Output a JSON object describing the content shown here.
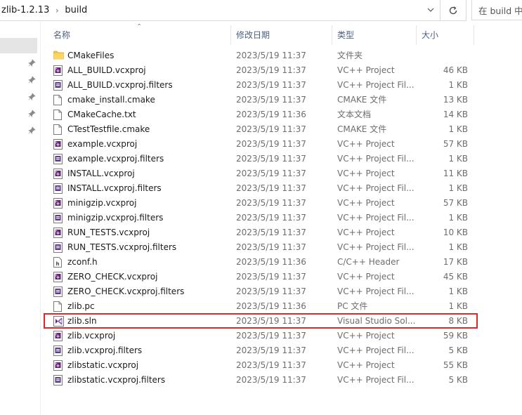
{
  "address": {
    "crumbs": [
      "zlib-1.2.13",
      "build"
    ],
    "search_placeholder": "在 build 中"
  },
  "columns": {
    "name": "名称",
    "date": "修改日期",
    "type": "类型",
    "size": "大小"
  },
  "files": [
    {
      "icon": "folder",
      "name": "CMakeFiles",
      "date": "2023/5/19 11:37",
      "type": "文件夹",
      "size": ""
    },
    {
      "icon": "vcxproj",
      "name": "ALL_BUILD.vcxproj",
      "date": "2023/5/19 11:37",
      "type": "VC++ Project",
      "size": "46 KB"
    },
    {
      "icon": "filters",
      "name": "ALL_BUILD.vcxproj.filters",
      "date": "2023/5/19 11:37",
      "type": "VC++ Project Fil...",
      "size": "1 KB"
    },
    {
      "icon": "document",
      "name": "cmake_install.cmake",
      "date": "2023/5/19 11:37",
      "type": "CMAKE 文件",
      "size": "13 KB"
    },
    {
      "icon": "document",
      "name": "CMakeCache.txt",
      "date": "2023/5/19 11:36",
      "type": "文本文档",
      "size": "14 KB"
    },
    {
      "icon": "document",
      "name": "CTestTestfile.cmake",
      "date": "2023/5/19 11:37",
      "type": "CMAKE 文件",
      "size": "1 KB"
    },
    {
      "icon": "vcxproj",
      "name": "example.vcxproj",
      "date": "2023/5/19 11:37",
      "type": "VC++ Project",
      "size": "57 KB"
    },
    {
      "icon": "filters",
      "name": "example.vcxproj.filters",
      "date": "2023/5/19 11:37",
      "type": "VC++ Project Fil...",
      "size": "1 KB"
    },
    {
      "icon": "vcxproj",
      "name": "INSTALL.vcxproj",
      "date": "2023/5/19 11:37",
      "type": "VC++ Project",
      "size": "11 KB"
    },
    {
      "icon": "filters",
      "name": "INSTALL.vcxproj.filters",
      "date": "2023/5/19 11:37",
      "type": "VC++ Project Fil...",
      "size": "1 KB"
    },
    {
      "icon": "vcxproj",
      "name": "minigzip.vcxproj",
      "date": "2023/5/19 11:37",
      "type": "VC++ Project",
      "size": "57 KB"
    },
    {
      "icon": "filters",
      "name": "minigzip.vcxproj.filters",
      "date": "2023/5/19 11:37",
      "type": "VC++ Project Fil...",
      "size": "1 KB"
    },
    {
      "icon": "vcxproj",
      "name": "RUN_TESTS.vcxproj",
      "date": "2023/5/19 11:37",
      "type": "VC++ Project",
      "size": "10 KB"
    },
    {
      "icon": "filters",
      "name": "RUN_TESTS.vcxproj.filters",
      "date": "2023/5/19 11:37",
      "type": "VC++ Project Fil...",
      "size": "1 KB"
    },
    {
      "icon": "header",
      "name": "zconf.h",
      "date": "2023/5/19 11:36",
      "type": "C/C++ Header",
      "size": "17 KB"
    },
    {
      "icon": "vcxproj",
      "name": "ZERO_CHECK.vcxproj",
      "date": "2023/5/19 11:37",
      "type": "VC++ Project",
      "size": "45 KB"
    },
    {
      "icon": "filters",
      "name": "ZERO_CHECK.vcxproj.filters",
      "date": "2023/5/19 11:37",
      "type": "VC++ Project Fil...",
      "size": "1 KB"
    },
    {
      "icon": "document",
      "name": "zlib.pc",
      "date": "2023/5/19 11:36",
      "type": "PC 文件",
      "size": "1 KB"
    },
    {
      "icon": "sln",
      "name": "zlib.sln",
      "date": "2023/5/19 11:37",
      "type": "Visual Studio Sol...",
      "size": "8 KB",
      "highlighted": true
    },
    {
      "icon": "vcxproj",
      "name": "zlib.vcxproj",
      "date": "2023/5/19 11:37",
      "type": "VC++ Project",
      "size": "59 KB"
    },
    {
      "icon": "filters",
      "name": "zlib.vcxproj.filters",
      "date": "2023/5/19 11:37",
      "type": "VC++ Project Fil...",
      "size": "5 KB"
    },
    {
      "icon": "vcxproj",
      "name": "zlibstatic.vcxproj",
      "date": "2023/5/19 11:37",
      "type": "VC++ Project",
      "size": "55 KB"
    },
    {
      "icon": "filters",
      "name": "zlibstatic.vcxproj.filters",
      "date": "2023/5/19 11:37",
      "type": "VC++ Project Fil...",
      "size": "5 KB"
    }
  ],
  "colors": {
    "highlight_border": "#d6282d",
    "header_text": "#4d6082",
    "folder": "#f3c24f",
    "vs_purple": "#68217a"
  }
}
